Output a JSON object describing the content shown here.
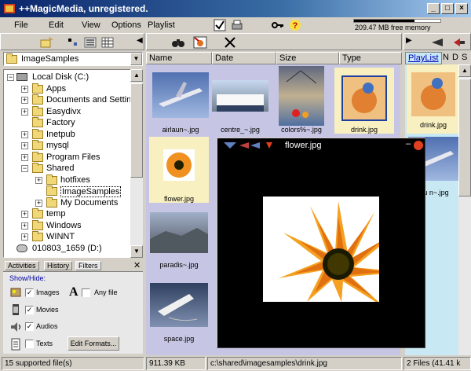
{
  "window": {
    "title": "++MagicMedia, unregistered.",
    "min": "_",
    "max": "□",
    "close": "×"
  },
  "menu": [
    "File",
    "Edit",
    "View",
    "Options",
    "Playlist"
  ],
  "memory": {
    "text": "209.47 MB free memory",
    "used_fraction": 0.7
  },
  "path_combo": {
    "value": "ImageSamples"
  },
  "tree": [
    {
      "label": "Local Disk (C:)",
      "level": 0,
      "pm": "−",
      "kind": "drive"
    },
    {
      "label": "Apps",
      "level": 1,
      "pm": "+"
    },
    {
      "label": "Documents and Settings",
      "level": 1,
      "pm": "+"
    },
    {
      "label": "Easydivx",
      "level": 1,
      "pm": "+"
    },
    {
      "label": "Factory",
      "level": 1,
      "pm": ""
    },
    {
      "label": "Inetpub",
      "level": 1,
      "pm": "+"
    },
    {
      "label": "mysql",
      "level": 1,
      "pm": "+"
    },
    {
      "label": "Program Files",
      "level": 1,
      "pm": "+"
    },
    {
      "label": "Shared",
      "level": 1,
      "pm": "−"
    },
    {
      "label": "hotfixes",
      "level": 2,
      "pm": "+"
    },
    {
      "label": "ImageSamples",
      "level": 2,
      "pm": "",
      "selected": true
    },
    {
      "label": "My Documents",
      "level": 2,
      "pm": "+"
    },
    {
      "label": "temp",
      "level": 1,
      "pm": "+"
    },
    {
      "label": "Windows",
      "level": 1,
      "pm": "+"
    },
    {
      "label": "WINNT",
      "level": 1,
      "pm": "+"
    },
    {
      "label": "010803_1659 (D:)",
      "level": 0,
      "pm": "",
      "kind": "cd"
    }
  ],
  "columns": [
    "Name",
    "Date",
    "Size",
    "Type"
  ],
  "thumbnails": [
    {
      "name": "airlaun~.jpg"
    },
    {
      "name": "centre_~.jpg"
    },
    {
      "name": "colors%~.jpg"
    },
    {
      "name": "drink.jpg"
    },
    {
      "name": "flower.jpg"
    },
    {
      "name": "paradis~.jpg"
    },
    {
      "name": "space.jpg"
    }
  ],
  "bottom_tabs": [
    "Activities",
    "History",
    "Filters"
  ],
  "filters": {
    "title": "Show/Hide:",
    "images": {
      "label": "Images",
      "checked": true
    },
    "anyfile": {
      "label": "Any file",
      "checked": false
    },
    "movies": {
      "label": "Movies",
      "checked": true
    },
    "audios": {
      "label": "Audios",
      "checked": true
    },
    "texts": {
      "label": "Texts",
      "checked": false
    },
    "edit_formats": "Edit Formats..."
  },
  "viewer": {
    "title": "flower.jpg"
  },
  "playlist": {
    "tabs": [
      "PlayList",
      "N",
      "D",
      "S"
    ],
    "items": [
      {
        "name": "drink.jpg"
      },
      {
        "name": "lau n~.jpg"
      }
    ]
  },
  "status": {
    "files": "15 supported file(s)",
    "size": "911.39 KB",
    "path": "c:\\shared\\imagesamples\\drink.jpg",
    "playlist": "2 Files (41.41 k"
  }
}
